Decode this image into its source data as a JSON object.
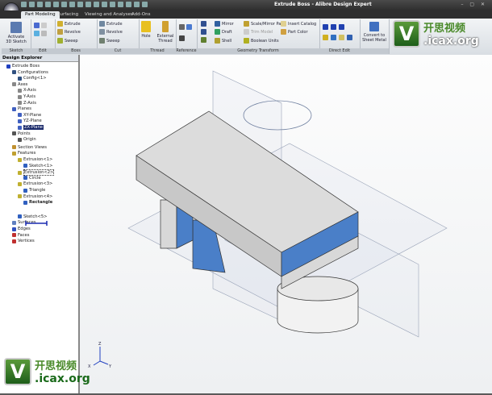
{
  "window": {
    "title": "Extrude Boss - Alibre Design Expert",
    "controls": "– ▢ ✕"
  },
  "tabs": [
    "Part Modeling",
    "Surfacing",
    "Viewing and Analyses",
    "Add-Ons"
  ],
  "ribbon": {
    "sketch": {
      "button": "Activate 3D Sketch",
      "label": "Sketch"
    },
    "edit": {
      "label": "Edit"
    },
    "boss": {
      "items": [
        "Extrude",
        "Revolve",
        "Sweep"
      ],
      "label": "Boss"
    },
    "cut": {
      "items": [
        "Extrude",
        "Revolve",
        "Sweep"
      ],
      "label": "Cut"
    },
    "thread": {
      "items": [
        "Hole",
        "External Thread"
      ],
      "label": "Thread"
    },
    "reference": {
      "label": "Reference"
    },
    "geometry": {
      "items": [
        "Mirror",
        "Draft",
        "Shell",
        "Scale/Mirror Part",
        "Trim Model",
        "Boolean Units",
        "Insert Catalog",
        "Part Color"
      ],
      "label": "Geometry Transform"
    },
    "direct_edit": {
      "label": "Direct Edit"
    },
    "sheet_metal": {
      "button": "Convert to Sheet Metal"
    }
  },
  "explorer": {
    "title": "Design Explorer",
    "nodes": [
      {
        "label": "Extrude Boss",
        "depth": 0,
        "color": "#2040c0"
      },
      {
        "label": "Configurations",
        "depth": 1,
        "color": "#305080"
      },
      {
        "label": "Config<1>",
        "depth": 2,
        "color": "#305080"
      },
      {
        "label": "Axes",
        "depth": 1,
        "color": "#888"
      },
      {
        "label": "X-Axis",
        "depth": 2,
        "color": "#888"
      },
      {
        "label": "Y-Axis",
        "depth": 2,
        "color": "#888"
      },
      {
        "label": "Z-Axis",
        "depth": 2,
        "color": "#888"
      },
      {
        "label": "Planes",
        "depth": 1,
        "color": "#4060c0"
      },
      {
        "label": "XY-Plane",
        "depth": 2,
        "color": "#4060c0"
      },
      {
        "label": "YZ-Plane",
        "depth": 2,
        "color": "#4060c0"
      },
      {
        "label": "ZX-Plane",
        "depth": 2,
        "color": "#4060c0",
        "state": "selected"
      },
      {
        "label": "Points",
        "depth": 1,
        "color": "#555"
      },
      {
        "label": "Origin",
        "depth": 2,
        "color": "#555"
      },
      {
        "label": "Section Views",
        "depth": 1,
        "color": "#c09030"
      },
      {
        "label": "Features",
        "depth": 1,
        "color": "#c0a030"
      },
      {
        "label": "Extrusion<1>",
        "depth": 2,
        "color": "#c0b030"
      },
      {
        "label": "Sketch<1>",
        "depth": 3,
        "color": "#3060c0"
      },
      {
        "label": "Extrusion<2>",
        "depth": 2,
        "color": "#c0b030",
        "state": "focused"
      },
      {
        "label": "Circle",
        "depth": 3,
        "color": "#3060c0"
      },
      {
        "label": "Extrusion<3>",
        "depth": 2,
        "color": "#c0b030"
      },
      {
        "label": "Triangle",
        "depth": 3,
        "color": "#3060c0"
      },
      {
        "label": "Extrusion<4>",
        "depth": 2,
        "color": "#c0b030"
      },
      {
        "label": "Rectangle",
        "depth": 3,
        "color": "#3060c0",
        "state": "bold"
      },
      {
        "label": "Sketch<5>",
        "depth": 2,
        "color": "#3060c0"
      },
      {
        "label": "Surfaces",
        "depth": 1,
        "color": "#6080c0"
      },
      {
        "label": "Edges",
        "depth": 1,
        "color": "#3050c0"
      },
      {
        "label": "Faces",
        "depth": 1,
        "color": "#c03030"
      },
      {
        "label": "Vertices",
        "depth": 1,
        "color": "#c03030"
      }
    ]
  },
  "watermark": {
    "cn": "开思视频",
    "en": ".icax.org",
    "letter": "V"
  },
  "axis_triad": [
    "X",
    "Y",
    "Z"
  ]
}
